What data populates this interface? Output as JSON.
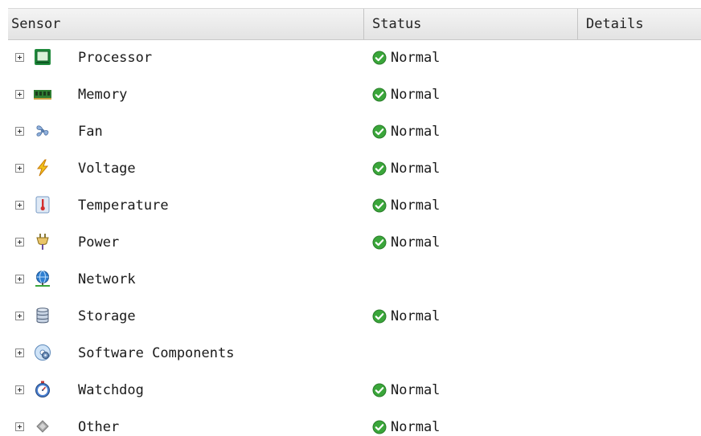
{
  "table": {
    "headers": {
      "sensor": "Sensor",
      "status": "Status",
      "details": "Details"
    },
    "rows": [
      {
        "name": "Processor",
        "icon": "processor-icon",
        "status": "Normal"
      },
      {
        "name": "Memory",
        "icon": "memory-icon",
        "status": "Normal"
      },
      {
        "name": "Fan",
        "icon": "fan-icon",
        "status": "Normal"
      },
      {
        "name": "Voltage",
        "icon": "voltage-icon",
        "status": "Normal"
      },
      {
        "name": "Temperature",
        "icon": "thermometer-icon",
        "status": "Normal"
      },
      {
        "name": "Power",
        "icon": "power-plug-icon",
        "status": "Normal"
      },
      {
        "name": "Network",
        "icon": "network-icon",
        "status": ""
      },
      {
        "name": "Storage",
        "icon": "storage-icon",
        "status": "Normal"
      },
      {
        "name": "Software Components",
        "icon": "software-components-icon",
        "status": ""
      },
      {
        "name": "Watchdog",
        "icon": "watchdog-icon",
        "status": "Normal"
      },
      {
        "name": "Other",
        "icon": "other-icon",
        "status": "Normal"
      }
    ]
  },
  "colors": {
    "status_ok": "#3aa63a",
    "header_bg": "#e8e8e8"
  }
}
